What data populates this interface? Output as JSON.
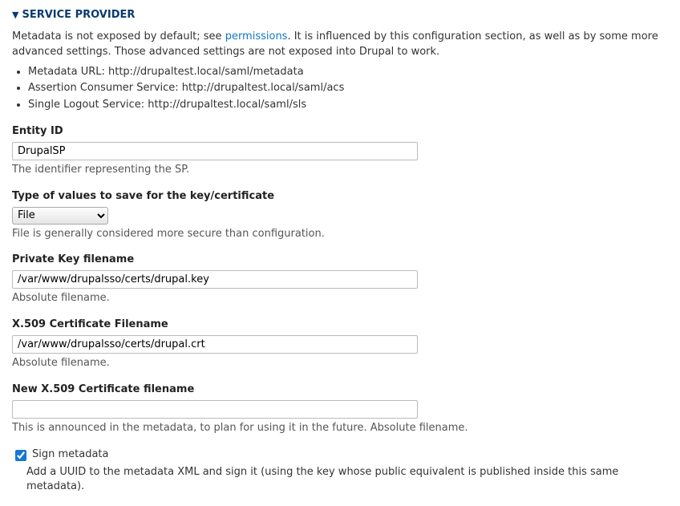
{
  "section": {
    "title": "SERVICE PROVIDER"
  },
  "intro": {
    "prefix": "Metadata is not exposed by default; see ",
    "link_text": "permissions",
    "suffix": ". It is influenced by this configuration section, as well as by some more advanced settings. Those advanced settings are not exposed into Drupal to work."
  },
  "meta": {
    "url_label": "Metadata URL: ",
    "url_value": "http://drupaltest.local/saml/metadata",
    "acs_label": "Assertion Consumer Service: ",
    "acs_value": "http://drupaltest.local/saml/acs",
    "sls_label": "Single Logout Service: ",
    "sls_value": "http://drupaltest.local/saml/sls"
  },
  "fields": {
    "entity_id": {
      "label": "Entity ID",
      "value": "DrupalSP",
      "help": "The identifier representing the SP."
    },
    "type_values": {
      "label": "Type of values to save for the key/certificate",
      "selected": "File",
      "help": "File is generally considered more secure than configuration."
    },
    "private_key": {
      "label": "Private Key filename",
      "value": "/var/www/drupalsso/certs/drupal.key",
      "help": "Absolute filename."
    },
    "x509": {
      "label": "X.509 Certificate Filename",
      "value": "/var/www/drupalsso/certs/drupal.crt",
      "help": "Absolute filename."
    },
    "new_x509": {
      "label": "New X.509 Certificate filename",
      "value": "",
      "help": "This is announced in the metadata, to plan for using it in the future. Absolute filename."
    },
    "sign_metadata": {
      "label": "Sign metadata",
      "checked": true,
      "help": "Add a UUID to the metadata XML and sign it (using the key whose public equivalent is published inside this same metadata)."
    }
  }
}
